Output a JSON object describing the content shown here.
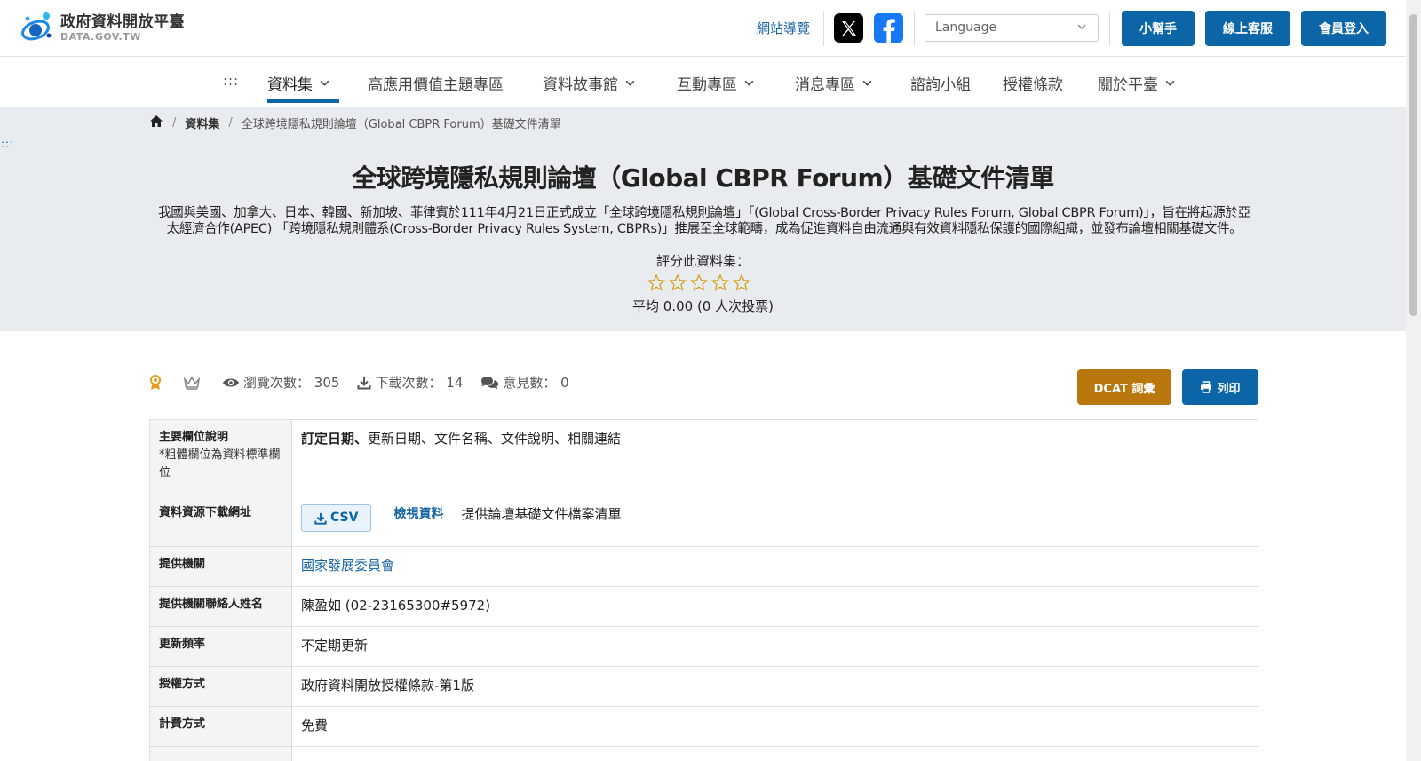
{
  "header": {
    "logo_cn": "政府資料開放平臺",
    "logo_en": "DATA.GOV.TW",
    "sitemap": "網站導覽",
    "language_placeholder": "Language",
    "buttons": {
      "helper": "小幫手",
      "service": "線上客服",
      "login": "會員登入"
    }
  },
  "nav": {
    "dots": ":::",
    "items": [
      "資料集",
      "高應用價值主題專區",
      "資料故事館",
      "互動專區",
      "消息專區",
      "諮詢小組",
      "授權條款",
      "關於平臺"
    ]
  },
  "breadcrumb": {
    "dataset": "資料集",
    "current": "全球跨境隱私規則論壇（Global CBPR Forum）基礎文件清單"
  },
  "side_dots": ":::",
  "dataset": {
    "title": "全球跨境隱私規則論壇（Global CBPR Forum）基礎文件清單",
    "description_line1": "我國與美國、加拿大、日本、韓國、新加坡、菲律賓於111年4月21日正式成立「全球跨境隱私規則論壇」「(Global Cross-Border Privacy Rules Forum, Global CBPR Forum)」，旨在將起源於亞",
    "description_line2": "太經濟合作(APEC) 「跨境隱私規則體系(Cross-Border Privacy Rules System, CBPRs)」推展至全球範疇，成為促進資料自由流通與有效資料隱私保護的國際組織，並發布論壇相關基礎文件。",
    "rate_label": "評分此資料集：",
    "rating": 0,
    "rating_max": 5,
    "average": "平均 0.00 (0 人次投票)"
  },
  "stats": {
    "views_label": "瀏覽次數：",
    "views": "305",
    "downloads_label": "下載次數：",
    "downloads": "14",
    "comments_label": "意見數：",
    "comments": "0"
  },
  "actions": {
    "dcat": "DCAT 詞彙",
    "print": "列印"
  },
  "table": {
    "fields": {
      "label": "主要欄位說明",
      "note": "*粗體欄位為資料標準欄位",
      "bold_field": "訂定日期、",
      "other_fields": "更新日期、文件名稱、文件說明、相關連結"
    },
    "resource": {
      "label": "資料資源下載網址",
      "csv": "CSV",
      "view": "檢視資料",
      "desc": "提供論壇基礎文件檔案清單"
    },
    "provider": {
      "label": "提供機關",
      "value": "國家發展委員會"
    },
    "contact": {
      "label": "提供機關聯絡人姓名",
      "value": "陳盈如 (02-23165300#5972)"
    },
    "frequency": {
      "label": "更新頻率",
      "value": "不定期更新"
    },
    "license": {
      "label": "授權方式",
      "value": "政府資料開放授權條款-第1版"
    },
    "fee": {
      "label": "計費方式",
      "value": "免費"
    }
  },
  "colors": {
    "primary": "#0b65a6",
    "dcat": "#b9770e",
    "hero_bg": "#e9ecef",
    "star": "#d4a017"
  }
}
